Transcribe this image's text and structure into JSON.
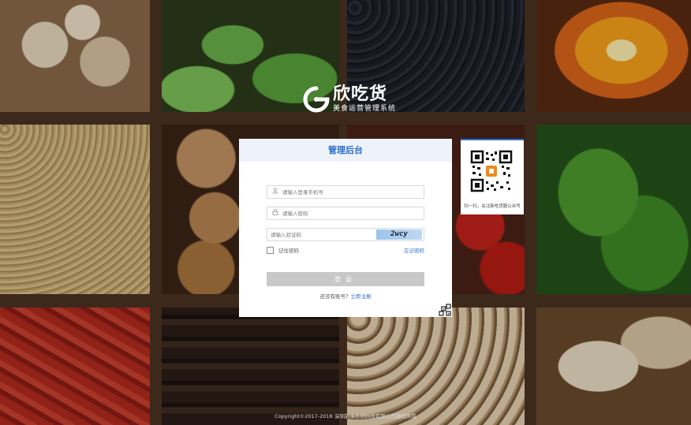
{
  "brand": {
    "name": "欣吃货",
    "tagline": "美食运营管理系统"
  },
  "login": {
    "title": "管理后台",
    "username_placeholder": "请输入登录手机号",
    "password_placeholder": "请输入密码",
    "captcha_placeholder": "请输入验证码",
    "captcha_text": "2wcy",
    "remember_label": "记住密码",
    "forgot_link": "忘记密码",
    "submit_label": "登录",
    "register_prompt": "还没有账号？",
    "register_link": "立即注册"
  },
  "qr": {
    "caption": "扫一扫，关注新吃货服公众号"
  },
  "footer": {
    "copyright": "Copyright©2017-2018 深圳前海吾德科技有限公司版权所有"
  },
  "colors": {
    "accent": "#2d6ed1",
    "header_bg": "#eef3fb",
    "button_disabled": "#c8c8c8"
  }
}
